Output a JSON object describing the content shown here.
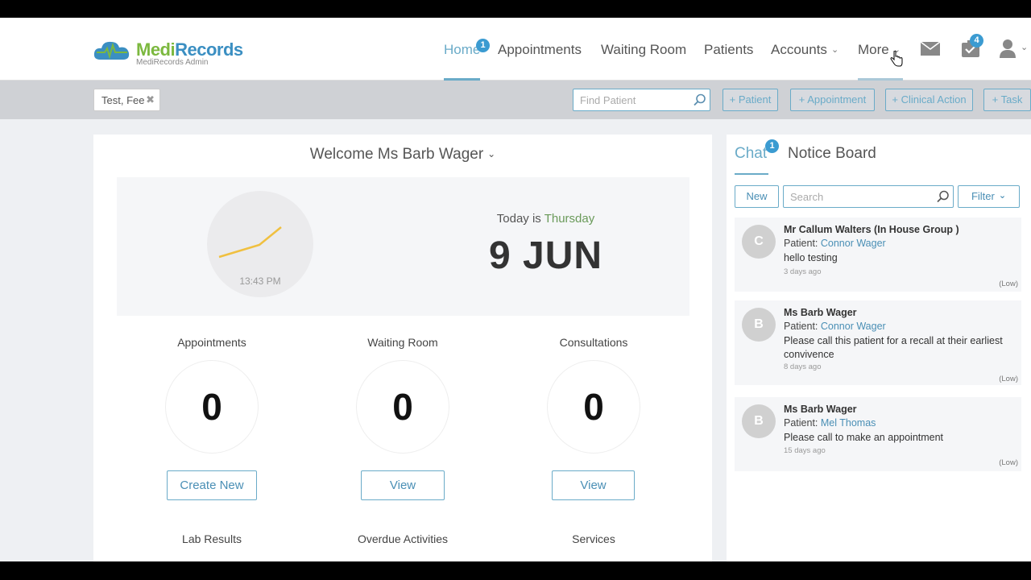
{
  "brand": {
    "name_part1": "Medi",
    "name_part2": "Records",
    "subtitle": "MediRecords Admin"
  },
  "nav": {
    "home": "Home",
    "home_badge": "1",
    "appointments": "Appointments",
    "waiting_room": "Waiting Room",
    "patients": "Patients",
    "accounts": "Accounts",
    "more": "More",
    "tasks_badge": "4"
  },
  "toolbar": {
    "patient_tag": "Test, Fee",
    "find_placeholder": "Find Patient",
    "btn_patient": "+ Patient",
    "btn_appointment": "+ Appointment",
    "btn_clinical": "+ Clinical Action",
    "btn_task": "+ Task"
  },
  "welcome": "Welcome Ms Barb Wager",
  "clock_time": "13:43 PM",
  "today_prefix": "Today is ",
  "today_day": "Thursday",
  "date": "9 JUN",
  "stats": {
    "appointments": {
      "label": "Appointments",
      "value": "0",
      "button": "Create New"
    },
    "waiting": {
      "label": "Waiting Room",
      "value": "0",
      "button": "View"
    },
    "consultations": {
      "label": "Consultations",
      "value": "0",
      "button": "View"
    }
  },
  "sub_labels": {
    "lab": "Lab Results",
    "overdue": "Overdue Activities",
    "services": "Services"
  },
  "side": {
    "tab_chat": "Chat",
    "chat_badge": "1",
    "tab_notice": "Notice Board",
    "new": "New",
    "search_placeholder": "Search",
    "filter": "Filter",
    "messages": [
      {
        "initial": "C",
        "from": "Mr Callum Walters (In House Group )",
        "patient_label": "Patient: ",
        "patient": "Connor Wager",
        "body": "hello testing",
        "ago": "3 days ago",
        "priority": "(Low)"
      },
      {
        "initial": "B",
        "from": "Ms Barb Wager",
        "patient_label": "Patient: ",
        "patient": "Connor Wager",
        "body": "Please call this patient for a recall at their earliest convivence",
        "ago": "8 days ago",
        "priority": "(Low)"
      },
      {
        "initial": "B",
        "from": "Ms Barb Wager",
        "patient_label": "Patient: ",
        "patient": "Mel Thomas",
        "body": "Please call to make an appointment",
        "ago": "15 days ago",
        "priority": "(Low)"
      }
    ]
  },
  "colors": {
    "accent": "#6aabc8",
    "brand_green": "#7cb83f",
    "brand_blue": "#3b8fc2",
    "badge": "#3b9bd1",
    "clock_hand": "#f0c040"
  }
}
